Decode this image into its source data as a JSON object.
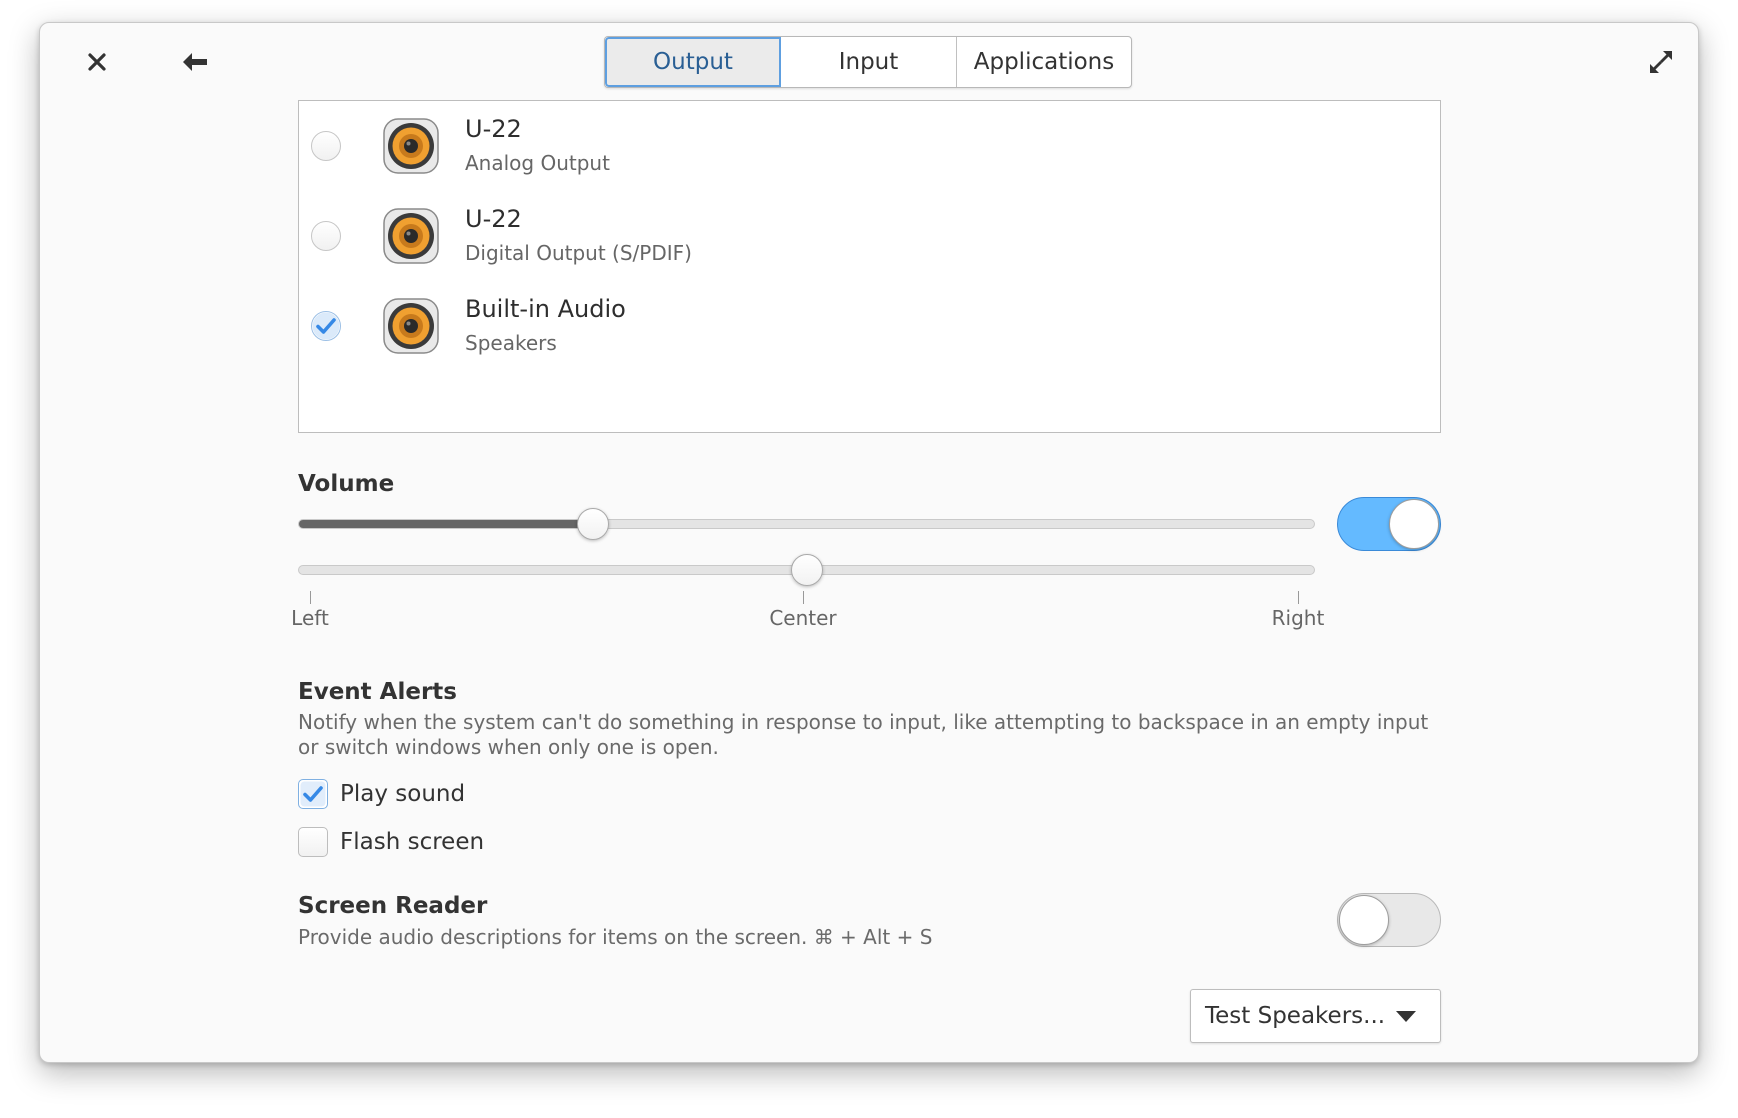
{
  "header": {
    "tabs": [
      {
        "label": "Output",
        "active": true
      },
      {
        "label": "Input",
        "active": false
      },
      {
        "label": "Applications",
        "active": false
      }
    ],
    "icons": {
      "close": "close-icon",
      "back": "back-arrow-icon",
      "maximize": "maximize-icon"
    }
  },
  "devices": [
    {
      "name": "U-22",
      "subtitle": "Analog Output",
      "selected": false,
      "icon": "speaker-icon"
    },
    {
      "name": "U-22",
      "subtitle": "Digital Output (S/PDIF)",
      "selected": false,
      "icon": "speaker-icon"
    },
    {
      "name": "Built-in Audio",
      "subtitle": "Speakers",
      "selected": true,
      "icon": "speaker-icon"
    }
  ],
  "volume": {
    "title": "Volume",
    "level": 0.29,
    "enabled": true,
    "balance": 0.5,
    "balance_labels": {
      "left": "Left",
      "center": "Center",
      "right": "Right"
    }
  },
  "event_alerts": {
    "title": "Event Alerts",
    "description": "Notify when the system can't do something in response to input, like attempting to backspace in an empty input or switch windows when only one is open.",
    "play_sound": {
      "label": "Play sound",
      "checked": true
    },
    "flash_screen": {
      "label": "Flash screen",
      "checked": false
    }
  },
  "screen_reader": {
    "title": "Screen Reader",
    "description": "Provide audio descriptions for items on the screen. ⌘ + Alt + S",
    "enabled": false
  },
  "test_speakers": {
    "label": "Test Speakers..."
  },
  "colors": {
    "accent": "#64baff",
    "accent_border": "#3a8ad8",
    "check": "#3689e6",
    "speaker_orange": "#f0a030"
  }
}
